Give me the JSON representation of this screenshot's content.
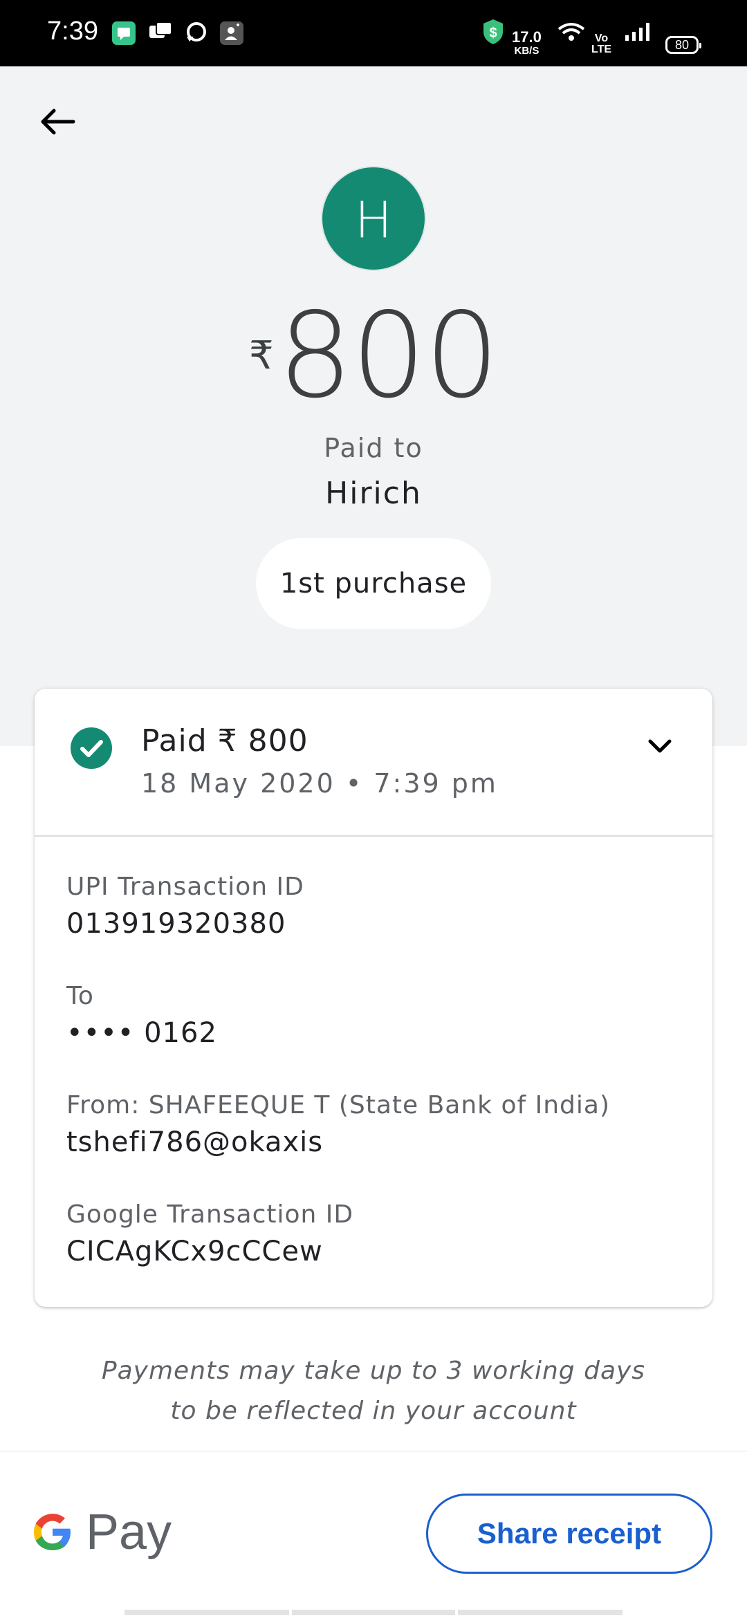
{
  "status_bar": {
    "time": "7:39",
    "net_speed_value": "17.0",
    "net_speed_unit": "KB/S",
    "volte_top": "Vo",
    "volte_bottom": "LTE",
    "battery": "80"
  },
  "header": {
    "avatar_letter": "H",
    "currency_symbol": "₹",
    "amount": "800",
    "paid_to_label": "Paid to",
    "payee_name": "Hirich",
    "chip_label": "1st purchase"
  },
  "card": {
    "title": "Paid ₹ 800",
    "datetime": "18 May 2020 • 7:39 pm",
    "status_color": "#148a73",
    "details": [
      {
        "label": "UPI Transaction ID",
        "value": "013919320380"
      },
      {
        "label": "To",
        "value": "•••• 0162"
      },
      {
        "label": "From: SHAFEEQUE  T (State Bank of India)",
        "value": "tshefi786@okaxis"
      },
      {
        "label": "Google Transaction ID",
        "value": "CICAgKCx9cCCew"
      }
    ]
  },
  "notice": {
    "line1": "Payments may take up to 3 working days",
    "line2": "to be reflected in your account"
  },
  "footer": {
    "brand": "Pay",
    "share_label": "Share receipt",
    "accent_color": "#1a5fd0"
  }
}
